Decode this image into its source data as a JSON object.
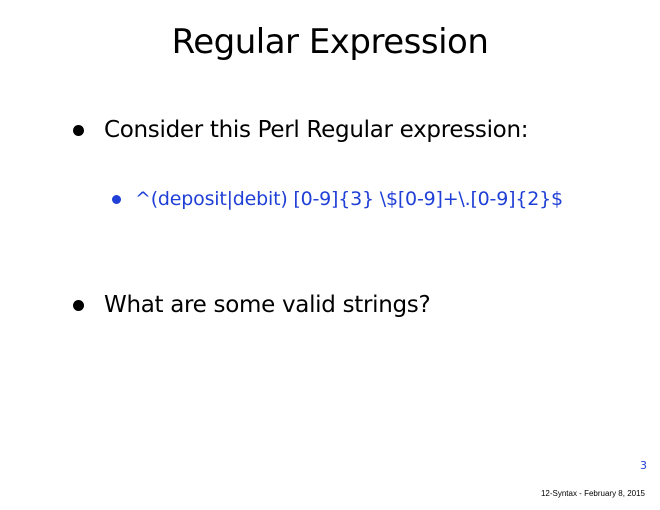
{
  "slide": {
    "title": "Regular Expression",
    "bullets": [
      {
        "text": "Consider this Perl Regular expression:",
        "sub_bullets": [
          {
            "text": "^(deposit|debit) [0-9]{3} \\$[0-9]+\\.[0-9]{2}$"
          }
        ]
      },
      {
        "text": "What are some valid strings?"
      }
    ],
    "page_number": "3",
    "footer": "12-Syntax - February 8, 2015"
  },
  "colors": {
    "text": "#000000",
    "accent_blue": "#1f3fd6",
    "background": "#ffffff"
  }
}
